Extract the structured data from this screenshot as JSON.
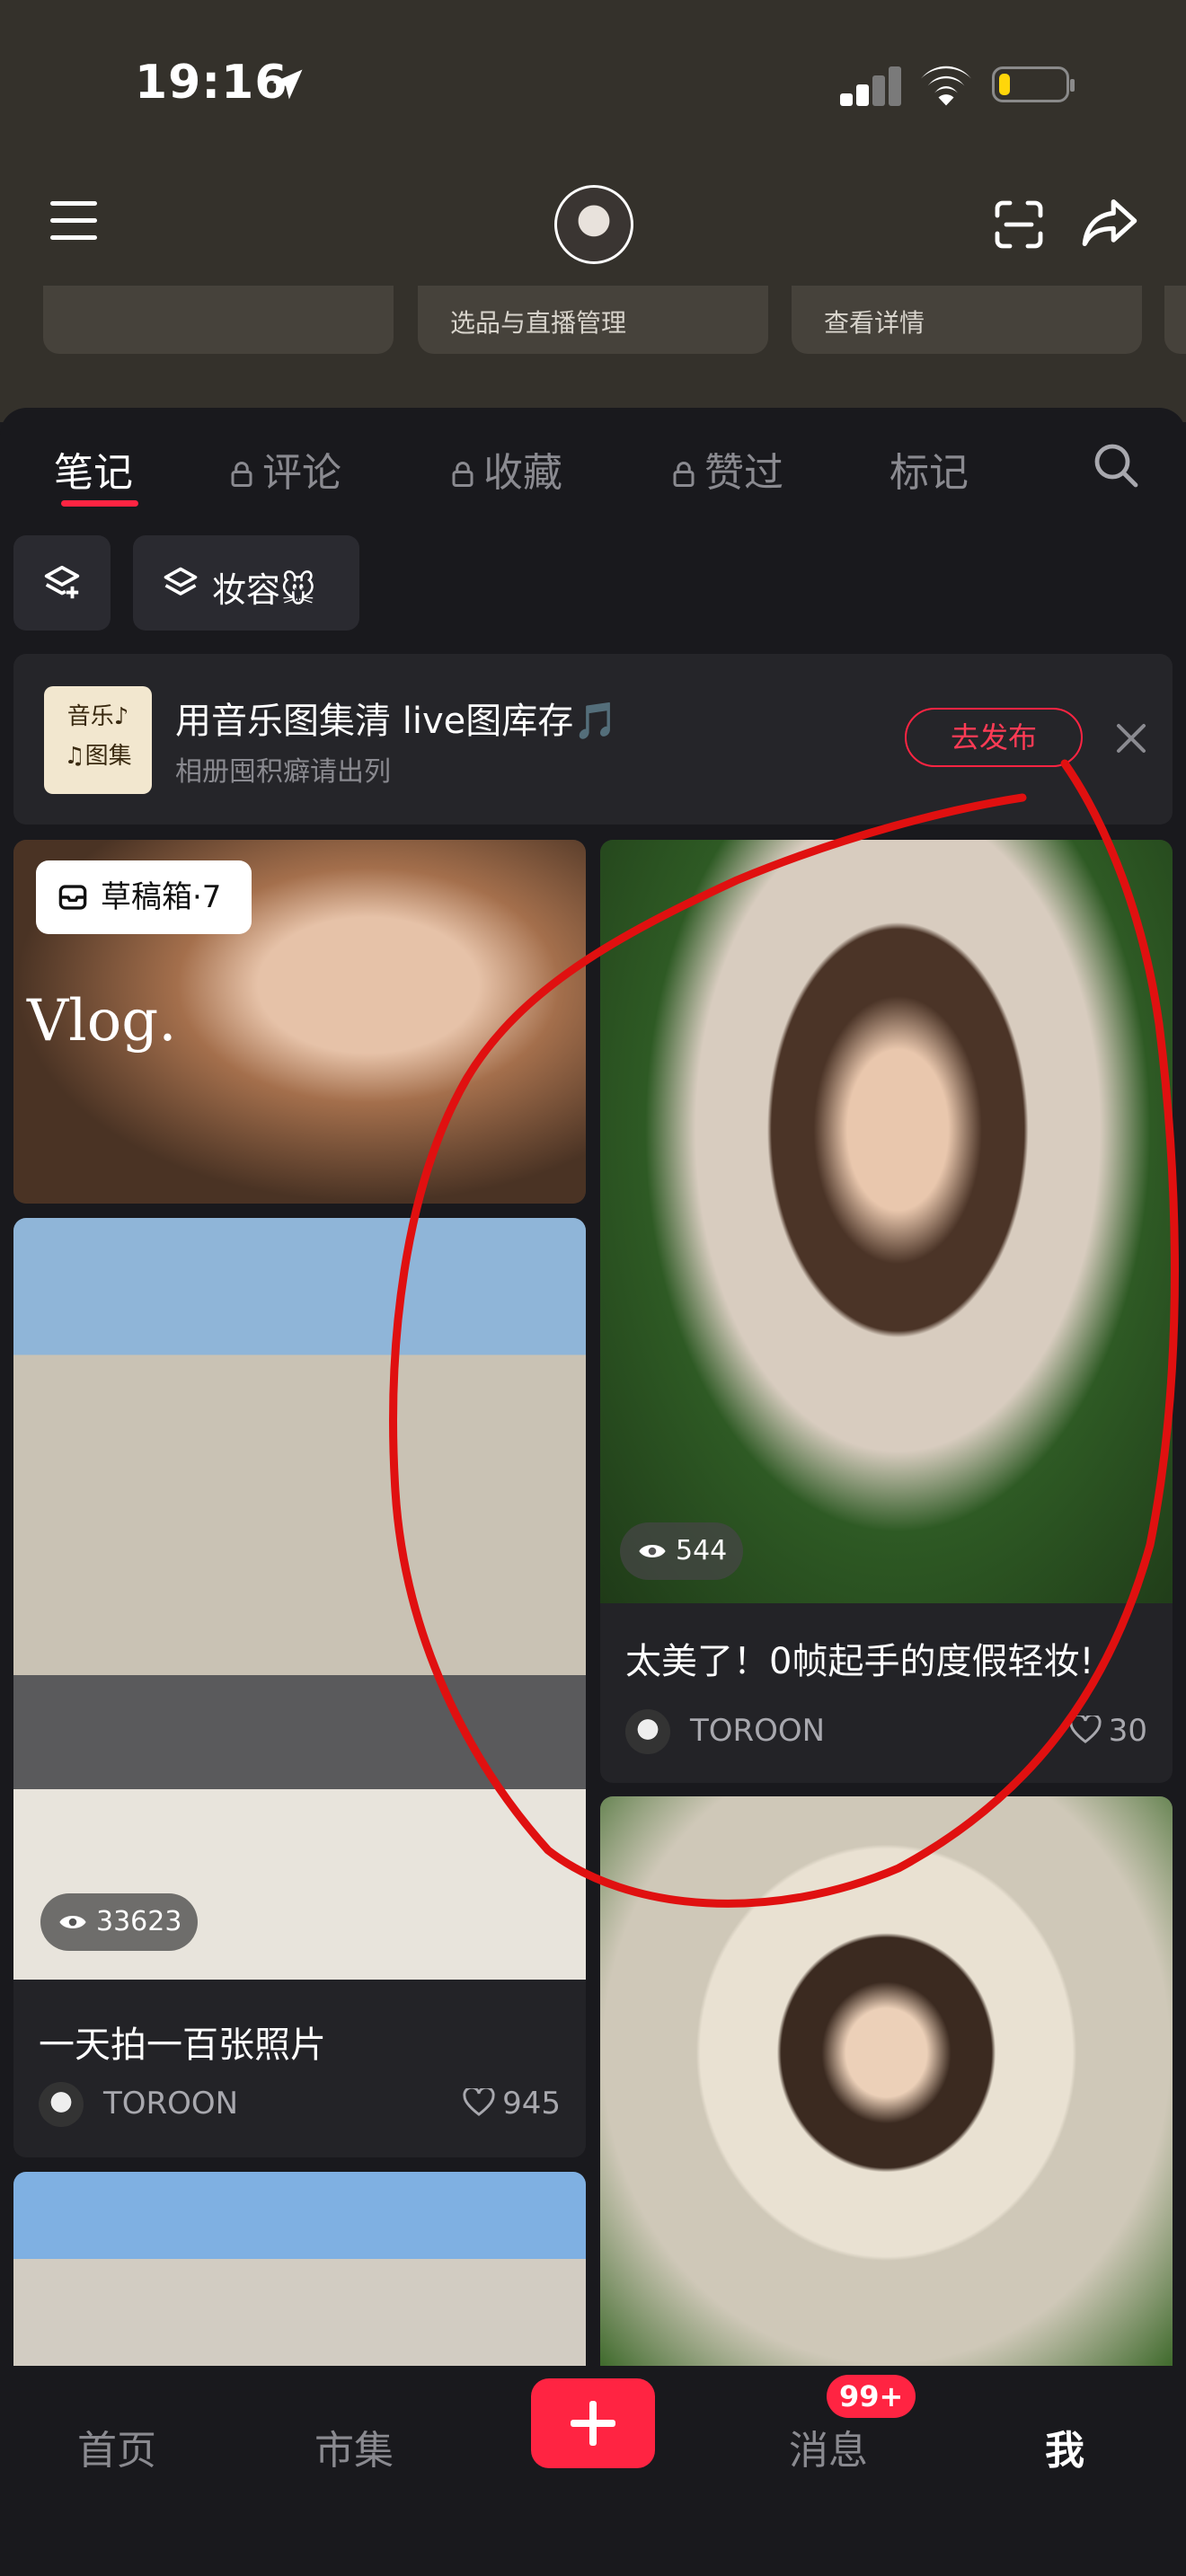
{
  "status_bar": {
    "time": "19:16"
  },
  "top_cards": [
    {
      "label": ""
    },
    {
      "label": "选品与直播管理"
    },
    {
      "label": "查看详情"
    }
  ],
  "tabs": [
    {
      "label": "笔记",
      "locked": false,
      "active": true
    },
    {
      "label": "评论",
      "locked": true,
      "active": false
    },
    {
      "label": "收藏",
      "locked": true,
      "active": false
    },
    {
      "label": "赞过",
      "locked": true,
      "active": false
    },
    {
      "label": "标记",
      "locked": false,
      "active": false
    }
  ],
  "filters": {
    "collection_label": "妆容🐭"
  },
  "banner": {
    "thumb_text": [
      "音乐♪",
      "♫图集"
    ],
    "title": "用音乐图集清 live图库存🎵",
    "subtitle": "相册囤积癖请出列",
    "button": "去发布"
  },
  "notes": [
    {
      "draft_label": "草稿箱·7",
      "overlay_text": "Vlog."
    },
    {
      "views": "544",
      "title": "太美了！0帧起手的度假轻妆!",
      "author": "TOROON",
      "likes": "30"
    },
    {
      "views": "33623",
      "title": "一天拍一百张照片",
      "author": "TOROON",
      "likes": "945"
    }
  ],
  "bottom_nav": {
    "home": "首页",
    "market": "市集",
    "messages": "消息",
    "messages_badge": "99+",
    "me": "我"
  },
  "colors": {
    "accent": "#ff2442",
    "header_bg": "#34312b",
    "panel_bg": "#19191d"
  }
}
